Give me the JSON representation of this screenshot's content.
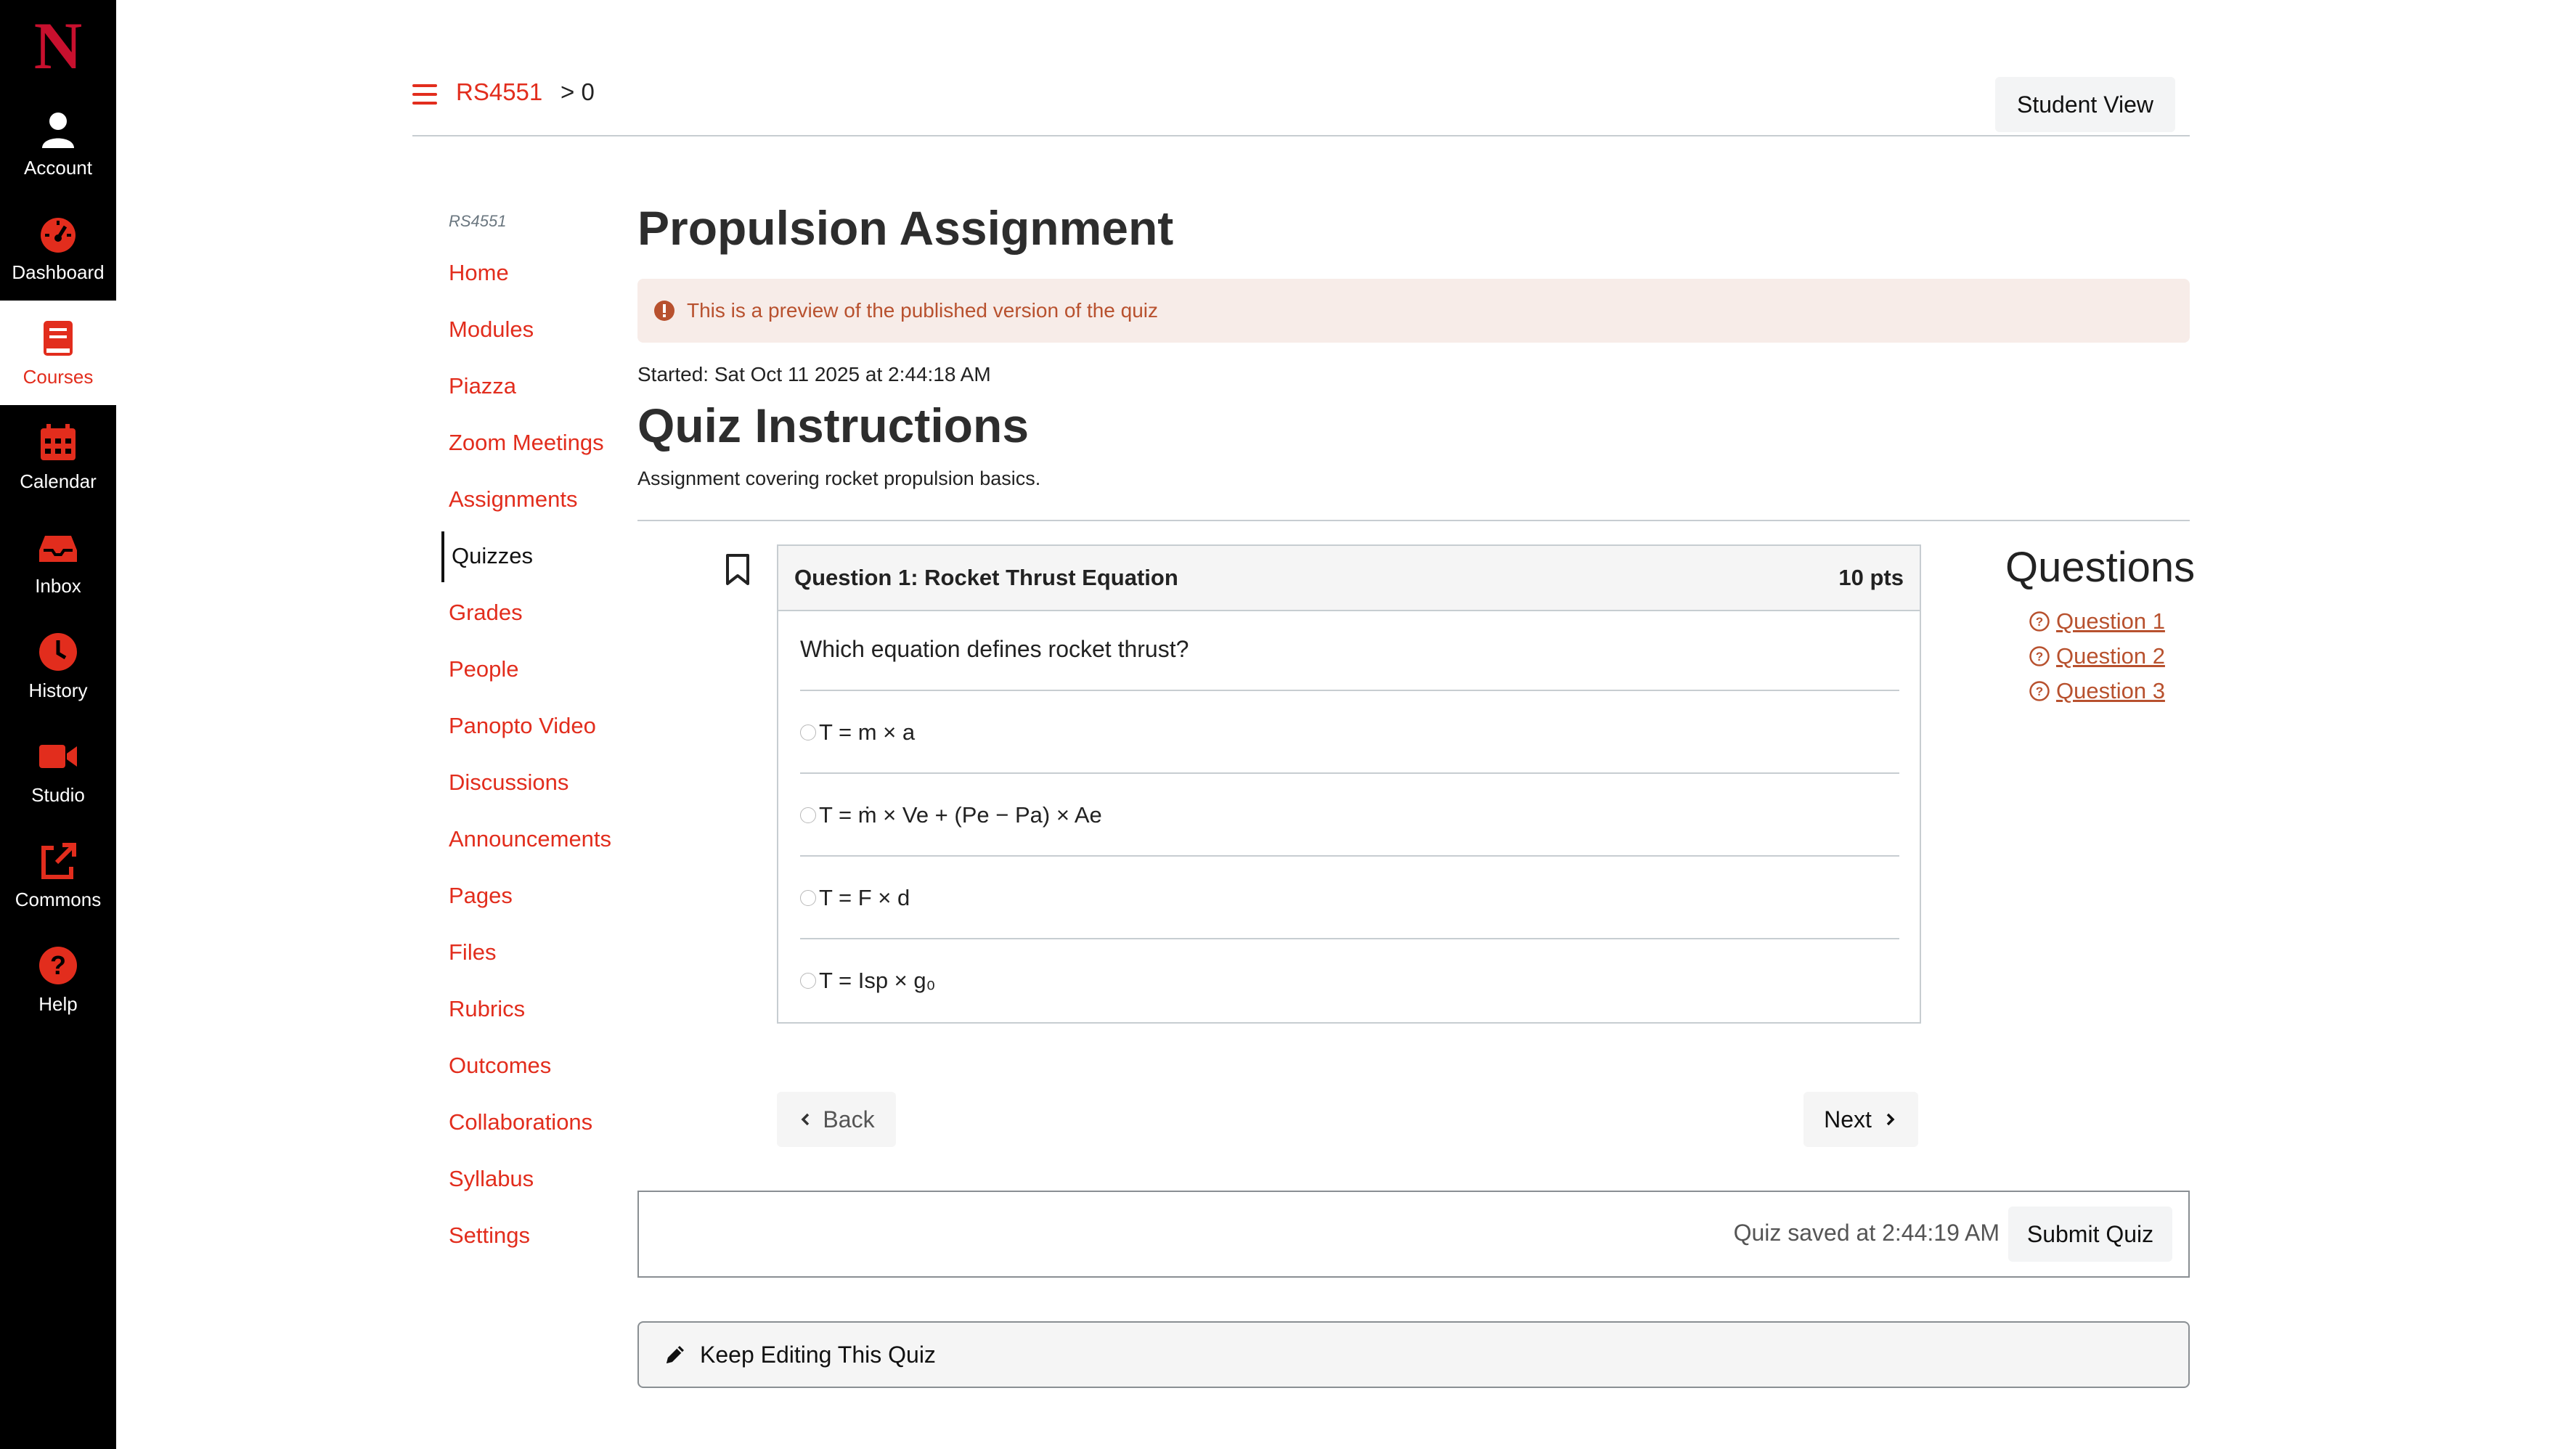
{
  "global_nav": {
    "logo": "N",
    "items": [
      {
        "label": "Account",
        "icon": "user-icon"
      },
      {
        "label": "Dashboard",
        "icon": "speedometer-icon"
      },
      {
        "label": "Courses",
        "icon": "book-icon",
        "active": true
      },
      {
        "label": "Calendar",
        "icon": "calendar-icon"
      },
      {
        "label": "Inbox",
        "icon": "inbox-icon"
      },
      {
        "label": "History",
        "icon": "clock-icon"
      },
      {
        "label": "Studio",
        "icon": "video-camera-icon"
      },
      {
        "label": "Commons",
        "icon": "share-icon"
      },
      {
        "label": "Help",
        "icon": "help-icon"
      }
    ]
  },
  "header": {
    "course": "RS4551",
    "crumb_rest": "> 0",
    "student_view": "Student View"
  },
  "course_nav": {
    "code": "RS4551",
    "items": [
      "Home",
      "Modules",
      "Piazza",
      "Zoom Meetings",
      "Assignments",
      "Quizzes",
      "Grades",
      "People",
      "Panopto Video",
      "Discussions",
      "Announcements",
      "Pages",
      "Files",
      "Rubrics",
      "Outcomes",
      "Collaborations",
      "Syllabus",
      "Settings"
    ],
    "active": "Quizzes"
  },
  "main": {
    "title": "Propulsion Assignment",
    "preview_alert": "This is a preview of the published version of the quiz",
    "started": "Started: Sat Oct 11 2025 at 2:44:18 AM",
    "instructions_title": "Quiz Instructions",
    "instructions_text": "Assignment covering rocket propulsion basics."
  },
  "question": {
    "title": "Question 1: Rocket Thrust Equation",
    "points": "10 pts",
    "text": "Which equation defines rocket thrust?",
    "answers": [
      "T = m × a",
      "T = ṁ × Ve + (Pe − Pa) × Ae",
      "T = F × d",
      "T = Isp × g₀"
    ]
  },
  "questions_panel": {
    "title": "Questions",
    "links": [
      "Question 1",
      "Question 2",
      "Question 3"
    ]
  },
  "nav_buttons": {
    "back": "Back",
    "next": "Next"
  },
  "submit": {
    "saved": "Quiz saved at 2:44:19 AM",
    "button": "Submit Quiz"
  },
  "keep_editing": "Keep Editing This Quiz",
  "colors": {
    "accent": "#e22d1d",
    "nav_bg": "#000000",
    "alert_bg": "#f7ece8",
    "alert_text": "#b8512e"
  }
}
